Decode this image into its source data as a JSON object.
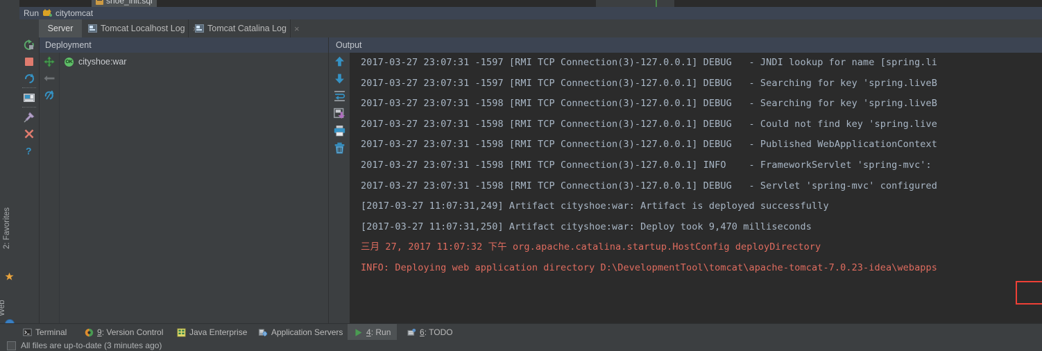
{
  "editor": {
    "tab_label": "shoe_init.sql",
    "tab_icon": "sql-file-icon"
  },
  "run_window": {
    "title": "Run",
    "config_name": "citytomcat",
    "config_icon": "tomcat-cat-icon",
    "tabs": [
      {
        "label": "Server",
        "icon": null,
        "selected": true,
        "closable": false
      },
      {
        "label": "Tomcat Localhost Log",
        "icon": "log-file-icon",
        "selected": false,
        "closable": true,
        "close_label": "×"
      },
      {
        "label": "Tomcat Catalina Log",
        "icon": "log-file-icon",
        "selected": false,
        "closable": true,
        "close_label": "×"
      }
    ],
    "side_tools": [
      {
        "name": "rerun-icon",
        "glyph": "rerun"
      },
      {
        "name": "stop-icon",
        "glyph": "stop"
      },
      {
        "name": "restart-icon",
        "glyph": "restart"
      },
      {
        "name": "console-icon",
        "glyph": "console"
      },
      {
        "name": "pin-icon",
        "glyph": "pin"
      },
      {
        "name": "close-icon",
        "glyph": "close"
      },
      {
        "name": "help-icon",
        "glyph": "help"
      }
    ]
  },
  "deployment": {
    "header": "Deployment",
    "tools": [
      {
        "name": "deploy-artifact-icon"
      },
      {
        "name": "undeploy-artifact-icon"
      },
      {
        "name": "redeploy-icon"
      }
    ],
    "artifacts": [
      {
        "label": "cityshoe:war",
        "status": "OK",
        "status_color": "#5fbf68"
      }
    ]
  },
  "output": {
    "header": "Output",
    "tools": [
      {
        "name": "scroll-up-icon"
      },
      {
        "name": "scroll-down-icon"
      },
      {
        "name": "soft-wrap-icon"
      },
      {
        "name": "export-to-file-icon"
      },
      {
        "name": "print-icon"
      },
      {
        "name": "clear-all-icon"
      }
    ],
    "highlight_color": "#ef4036",
    "highlight_target": "Deploy took 9,470 milliseconds",
    "lines": [
      {
        "text": "2017-03-27 23:07:31 -1597 [RMI TCP Connection(3)-127.0.0.1] DEBUG   - JNDI lookup for name [spring.li",
        "color": "grey"
      },
      {
        "text": "2017-03-27 23:07:31 -1597 [RMI TCP Connection(3)-127.0.0.1] DEBUG   - Searching for key 'spring.liveB",
        "color": "grey"
      },
      {
        "text": "2017-03-27 23:07:31 -1598 [RMI TCP Connection(3)-127.0.0.1] DEBUG   - Searching for key 'spring.liveB",
        "color": "grey"
      },
      {
        "text": "2017-03-27 23:07:31 -1598 [RMI TCP Connection(3)-127.0.0.1] DEBUG   - Could not find key 'spring.live",
        "color": "grey"
      },
      {
        "text": "2017-03-27 23:07:31 -1598 [RMI TCP Connection(3)-127.0.0.1] DEBUG   - Published WebApplicationContext",
        "color": "grey"
      },
      {
        "text": "2017-03-27 23:07:31 -1598 [RMI TCP Connection(3)-127.0.0.1] INFO    - FrameworkServlet 'spring-mvc': ",
        "color": "grey"
      },
      {
        "text": "2017-03-27 23:07:31 -1598 [RMI TCP Connection(3)-127.0.0.1] DEBUG   - Servlet 'spring-mvc' configured",
        "color": "grey"
      },
      {
        "text": "[2017-03-27 11:07:31,249] Artifact cityshoe:war: Artifact is deployed successfully",
        "color": "grey"
      },
      {
        "text": "[2017-03-27 11:07:31,250] Artifact cityshoe:war: Deploy took 9,470 milliseconds",
        "color": "grey"
      },
      {
        "text": "三月 27, 2017 11:07:32 下午 org.apache.catalina.startup.HostConfig deployDirectory",
        "color": "red"
      },
      {
        "text": "INFO: Deploying web application directory D:\\DevelopmentTool\\tomcat\\apache-tomcat-7.0.23-idea\\webapps",
        "color": "red"
      }
    ]
  },
  "left_strip": {
    "items": [
      {
        "label": "2: Favorites",
        "icon": "star-icon"
      },
      {
        "label": "Web",
        "icon": "globe-icon"
      }
    ]
  },
  "bottom_bar": {
    "items": [
      {
        "label": "Terminal",
        "icon": "terminal-icon",
        "mnemonic": "",
        "selected": false
      },
      {
        "label": ": Version Control",
        "icon": "version-control-icon",
        "mnemonic": "9",
        "selected": false
      },
      {
        "label": "Java Enterprise",
        "icon": "java-enterprise-icon",
        "mnemonic": "",
        "selected": false
      },
      {
        "label": "Application Servers",
        "icon": "application-servers-icon",
        "mnemonic": "",
        "selected": false
      },
      {
        "label": ": Run",
        "icon": "run-icon",
        "mnemonic": "4",
        "selected": true
      },
      {
        "label": ": TODO",
        "icon": "todo-icon",
        "mnemonic": "6",
        "selected": false
      }
    ]
  },
  "status_bar": {
    "text": "All files are up-to-date (3 minutes ago)",
    "icon": "checkbox-icon"
  }
}
